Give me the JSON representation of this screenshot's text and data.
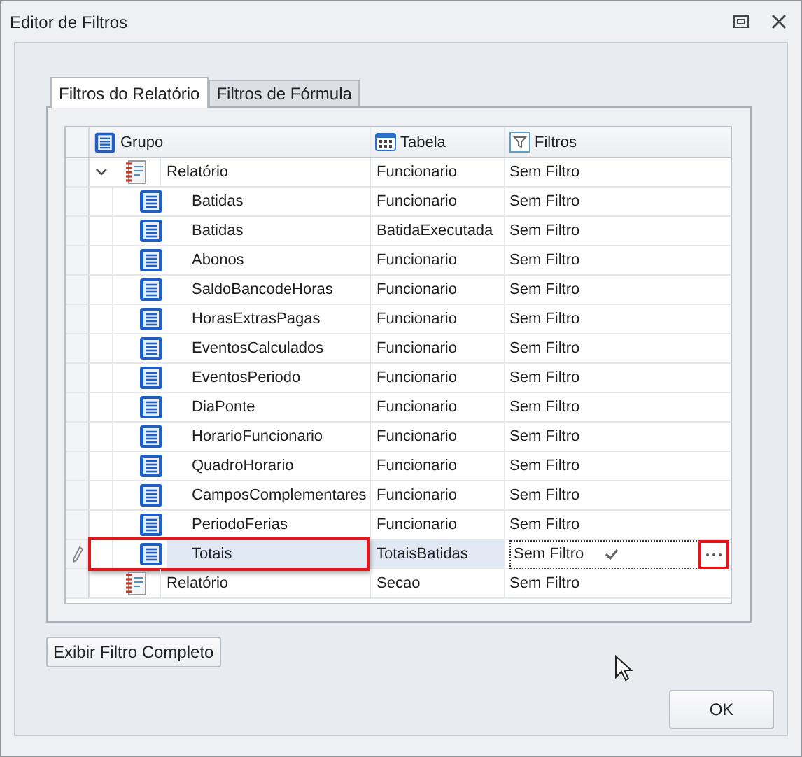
{
  "window": {
    "title": "Editor de Filtros"
  },
  "tabs": [
    {
      "label": "Filtros do Relatório",
      "selected": true
    },
    {
      "label": "Filtros de Fórmula",
      "selected": false
    }
  ],
  "grid": {
    "columns": [
      {
        "kind": "group",
        "label": "Grupo"
      },
      {
        "kind": "table",
        "label": "Tabela"
      },
      {
        "kind": "filter",
        "label": "Filtros"
      }
    ],
    "rows": [
      {
        "kind": "report",
        "grupo": "Relatório",
        "tabela": "Funcionario",
        "filtros": "Sem Filtro",
        "expanded": true,
        "selected": false,
        "annotated": false,
        "children": [
          {
            "kind": "table",
            "grupo": "Batidas",
            "tabela": "Funcionario",
            "filtros": "Sem Filtro",
            "selected": false,
            "annotated": false
          },
          {
            "kind": "table",
            "grupo": "Batidas",
            "tabela": "BatidaExecutada",
            "filtros": "Sem Filtro",
            "selected": false,
            "annotated": false
          },
          {
            "kind": "table",
            "grupo": "Abonos",
            "tabela": "Funcionario",
            "filtros": "Sem Filtro",
            "selected": false,
            "annotated": false
          },
          {
            "kind": "table",
            "grupo": "SaldoBancodeHoras",
            "tabela": "Funcionario",
            "filtros": "Sem Filtro",
            "selected": false,
            "annotated": false
          },
          {
            "kind": "table",
            "grupo": "HorasExtrasPagas",
            "tabela": "Funcionario",
            "filtros": "Sem Filtro",
            "selected": false,
            "annotated": false
          },
          {
            "kind": "table",
            "grupo": "EventosCalculados",
            "tabela": "Funcionario",
            "filtros": "Sem Filtro",
            "selected": false,
            "annotated": false
          },
          {
            "kind": "table",
            "grupo": "EventosPeriodo",
            "tabela": "Funcionario",
            "filtros": "Sem Filtro",
            "selected": false,
            "annotated": false
          },
          {
            "kind": "table",
            "grupo": "DiaPonte",
            "tabela": "Funcionario",
            "filtros": "Sem Filtro",
            "selected": false,
            "annotated": false
          },
          {
            "kind": "table",
            "grupo": "HorarioFuncionario",
            "tabela": "Funcionario",
            "filtros": "Sem Filtro",
            "selected": false,
            "annotated": false
          },
          {
            "kind": "table",
            "grupo": "QuadroHorario",
            "tabela": "Funcionario",
            "filtros": "Sem Filtro",
            "selected": false,
            "annotated": false
          },
          {
            "kind": "table",
            "grupo": "CamposComplementares",
            "tabela": "Funcionario",
            "filtros": "Sem Filtro",
            "selected": false,
            "annotated": false
          },
          {
            "kind": "table",
            "grupo": "PeriodoFerias",
            "tabela": "Funcionario",
            "filtros": "Sem Filtro",
            "selected": false,
            "annotated": false
          },
          {
            "kind": "table",
            "grupo": "Totais",
            "tabela": "TotaisBatidas",
            "filtros": "Sem Filtro",
            "selected": true,
            "annotated": true
          }
        ]
      },
      {
        "kind": "report",
        "grupo": "Relatório",
        "tabela": "Secao",
        "filtros": "Sem Filtro",
        "selected": false,
        "annotated": false
      }
    ]
  },
  "buttons": [
    {
      "kind": "secondary",
      "label": "Exibir Filtro Completo"
    },
    {
      "kind": "primary",
      "label": "OK"
    }
  ]
}
